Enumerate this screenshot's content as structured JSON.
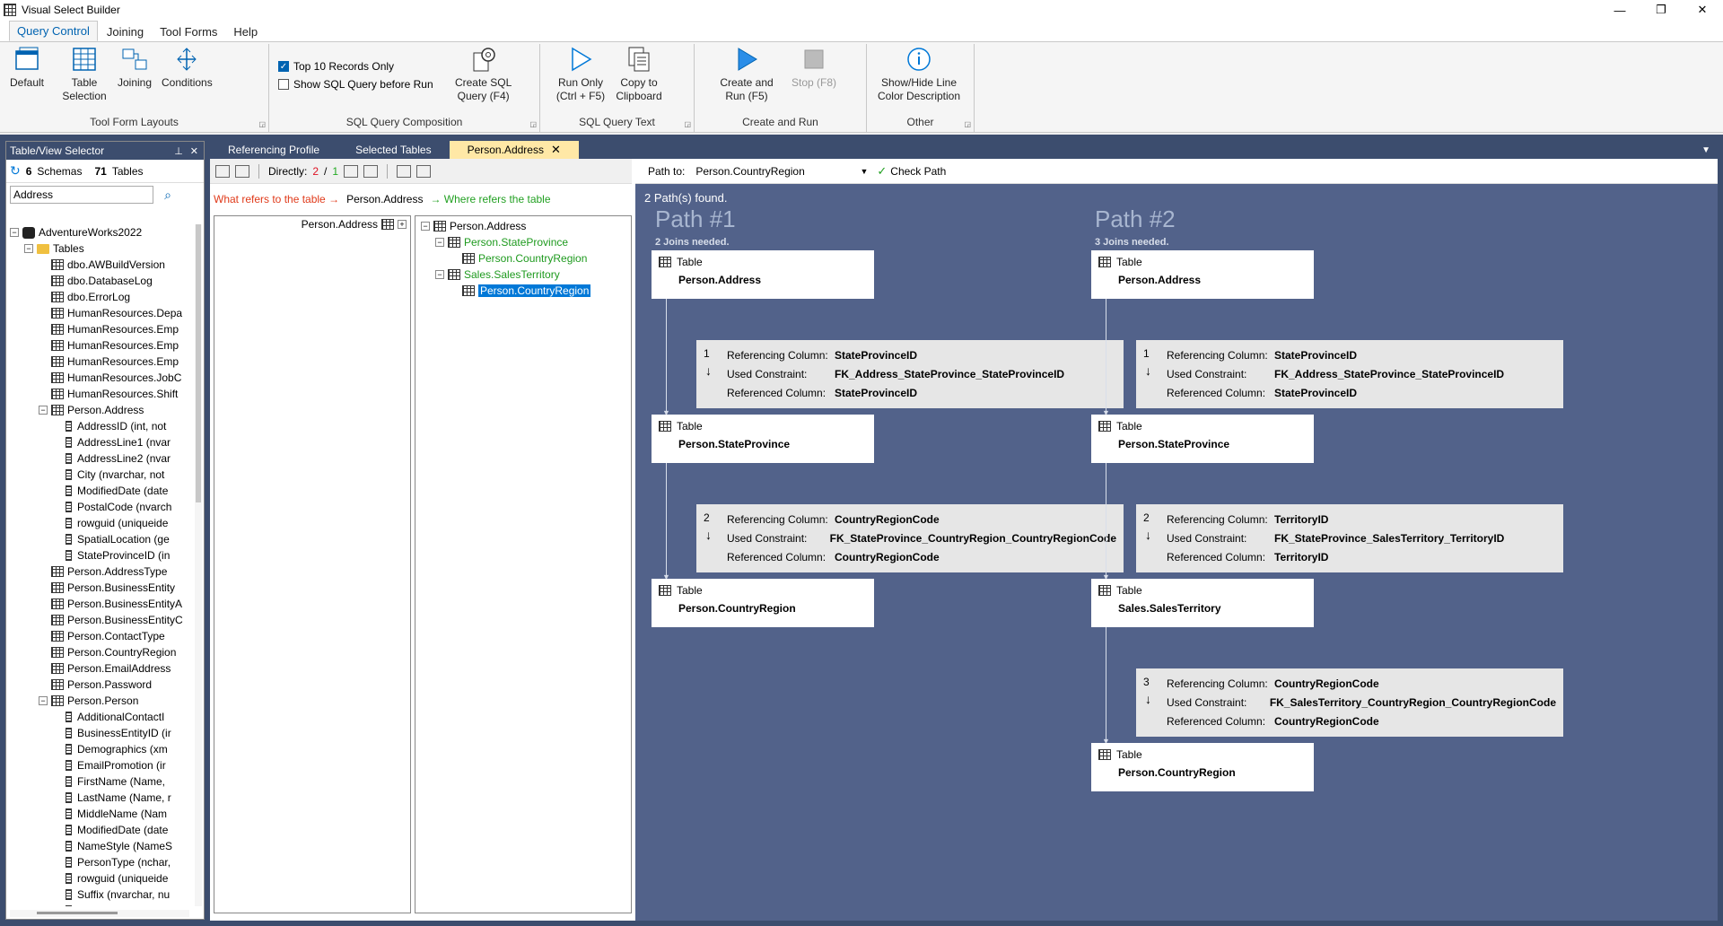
{
  "window": {
    "title": "Visual Select Builder",
    "minimize": "—",
    "maximize": "❐",
    "close": "✕"
  },
  "menu_tabs": [
    "Query Control",
    "Joining",
    "Tool Forms",
    "Help"
  ],
  "ribbon": {
    "groups": [
      {
        "label": "Tool Form Layouts",
        "buttons": [
          "Default",
          "Table Selection",
          "Joining",
          "Conditions"
        ]
      },
      {
        "label": "SQL Query Composition",
        "checkboxes": [
          {
            "label": "Top 10 Records Only",
            "checked": true
          },
          {
            "label": "Show SQL Query before Run",
            "checked": false
          }
        ],
        "buttons": [
          "Create SQL Query (F4)"
        ]
      },
      {
        "label": "SQL Query Text",
        "buttons": [
          "Run Only (Ctrl + F5)",
          "Copy to Clipboard"
        ]
      },
      {
        "label": "Create and Run",
        "buttons": [
          "Create and Run (F5)",
          "Stop (F8)"
        ]
      },
      {
        "label": "Other",
        "buttons": [
          "Show/Hide Line Color Description"
        ]
      }
    ]
  },
  "left_panel": {
    "title": "Table/View Selector",
    "schemas_count": "6",
    "schemas_label": "Schemas",
    "tables_count": "71",
    "tables_label": "Tables",
    "search_value": "Address",
    "tree": [
      {
        "level": 0,
        "kind": "db",
        "exp": "−",
        "label": "AdventureWorks2022"
      },
      {
        "level": 1,
        "kind": "folder",
        "exp": "−",
        "label": "Tables"
      },
      {
        "level": 2,
        "kind": "table",
        "label": "dbo.AWBuildVersion"
      },
      {
        "level": 2,
        "kind": "table",
        "label": "dbo.DatabaseLog"
      },
      {
        "level": 2,
        "kind": "table",
        "label": "dbo.ErrorLog"
      },
      {
        "level": 2,
        "kind": "table",
        "label": "HumanResources.Depa"
      },
      {
        "level": 2,
        "kind": "table",
        "label": "HumanResources.Emp"
      },
      {
        "level": 2,
        "kind": "table",
        "label": "HumanResources.Emp"
      },
      {
        "level": 2,
        "kind": "table",
        "label": "HumanResources.Emp"
      },
      {
        "level": 2,
        "kind": "table",
        "label": "HumanResources.JobC"
      },
      {
        "level": 2,
        "kind": "table",
        "label": "HumanResources.Shift"
      },
      {
        "level": 2,
        "kind": "table",
        "exp": "−",
        "label": "Person.Address"
      },
      {
        "level": 3,
        "kind": "col",
        "label": "AddressID (int, not"
      },
      {
        "level": 3,
        "kind": "col",
        "label": "AddressLine1 (nvar"
      },
      {
        "level": 3,
        "kind": "col",
        "label": "AddressLine2 (nvar"
      },
      {
        "level": 3,
        "kind": "col",
        "label": "City (nvarchar, not"
      },
      {
        "level": 3,
        "kind": "col",
        "label": "ModifiedDate (date"
      },
      {
        "level": 3,
        "kind": "col",
        "label": "PostalCode (nvarch"
      },
      {
        "level": 3,
        "kind": "col",
        "label": "rowguid (uniqueide"
      },
      {
        "level": 3,
        "kind": "col",
        "label": "SpatialLocation (ge"
      },
      {
        "level": 3,
        "kind": "col",
        "label": "StateProvinceID (in"
      },
      {
        "level": 2,
        "kind": "table",
        "label": "Person.AddressType"
      },
      {
        "level": 2,
        "kind": "table",
        "label": "Person.BusinessEntity"
      },
      {
        "level": 2,
        "kind": "table",
        "label": "Person.BusinessEntityA"
      },
      {
        "level": 2,
        "kind": "table",
        "label": "Person.BusinessEntityC"
      },
      {
        "level": 2,
        "kind": "table",
        "label": "Person.ContactType"
      },
      {
        "level": 2,
        "kind": "table",
        "label": "Person.CountryRegion"
      },
      {
        "level": 2,
        "kind": "table",
        "label": "Person.EmailAddress"
      },
      {
        "level": 2,
        "kind": "table",
        "label": "Person.Password"
      },
      {
        "level": 2,
        "kind": "table",
        "exp": "−",
        "label": "Person.Person"
      },
      {
        "level": 3,
        "kind": "col",
        "label": "AdditionalContactI"
      },
      {
        "level": 3,
        "kind": "col",
        "label": "BusinessEntityID (ir"
      },
      {
        "level": 3,
        "kind": "col",
        "label": "Demographics (xm"
      },
      {
        "level": 3,
        "kind": "col",
        "label": "EmailPromotion (ir"
      },
      {
        "level": 3,
        "kind": "col",
        "label": "FirstName (Name,"
      },
      {
        "level": 3,
        "kind": "col",
        "label": "LastName (Name, r"
      },
      {
        "level": 3,
        "kind": "col",
        "label": "MiddleName (Nam"
      },
      {
        "level": 3,
        "kind": "col",
        "label": "ModifiedDate (date"
      },
      {
        "level": 3,
        "kind": "col",
        "label": "NameStyle (NameS"
      },
      {
        "level": 3,
        "kind": "col",
        "label": "PersonType (nchar,"
      },
      {
        "level": 3,
        "kind": "col",
        "label": "rowguid (uniqueide"
      },
      {
        "level": 3,
        "kind": "col",
        "label": "Suffix (nvarchar, nu"
      },
      {
        "level": 3,
        "kind": "col",
        "label": "Title (nvarchar, null"
      }
    ]
  },
  "doc_tabs": [
    "Referencing Profile",
    "Selected Tables",
    "Person.Address"
  ],
  "toolbar": {
    "directly_label": "Directly:",
    "count_left": "2",
    "slash": "/",
    "count_right": "1"
  },
  "legend": {
    "refers": "What refers to the table →",
    "table": "Person.Address",
    "where": "→ Where refers the table"
  },
  "ref_list": {
    "item": "Person.Address"
  },
  "where_tree": [
    {
      "level": 0,
      "exp": "−",
      "label": "Person.Address",
      "style": "plain"
    },
    {
      "level": 1,
      "exp": "−",
      "label": "Person.StateProvince",
      "style": "green"
    },
    {
      "level": 2,
      "label": "Person.CountryRegion",
      "style": "green"
    },
    {
      "level": 1,
      "exp": "−",
      "label": "Sales.SalesTerritory",
      "style": "green"
    },
    {
      "level": 2,
      "label": "Person.CountryRegion",
      "style": "selected"
    }
  ],
  "path_bar": {
    "label": "Path to:",
    "value": "Person.CountryRegion",
    "check": "Check Path"
  },
  "found": "2 Path(s) found.",
  "table_word": "Table",
  "join_labels": {
    "ref_col": "Referencing Column:",
    "constraint": "Used Constraint:",
    "refd_col": "Referenced Column:"
  },
  "paths": [
    {
      "title": "Path #1",
      "subtitle": "2 Joins needed.",
      "tables": [
        "Person.Address",
        "Person.StateProvince",
        "Person.CountryRegion"
      ],
      "joins": [
        {
          "n": "1",
          "ref": "StateProvinceID",
          "constraint": "FK_Address_StateProvince_StateProvinceID",
          "refd": "StateProvinceID"
        },
        {
          "n": "2",
          "ref": "CountryRegionCode",
          "constraint": "FK_StateProvince_CountryRegion_CountryRegionCode",
          "refd": "CountryRegionCode"
        }
      ]
    },
    {
      "title": "Path #2",
      "subtitle": "3 Joins needed.",
      "tables": [
        "Person.Address",
        "Person.StateProvince",
        "Sales.SalesTerritory",
        "Person.CountryRegion"
      ],
      "joins": [
        {
          "n": "1",
          "ref": "StateProvinceID",
          "constraint": "FK_Address_StateProvince_StateProvinceID",
          "refd": "StateProvinceID"
        },
        {
          "n": "2",
          "ref": "TerritoryID",
          "constraint": "FK_StateProvince_SalesTerritory_TerritoryID",
          "refd": "TerritoryID"
        },
        {
          "n": "3",
          "ref": "CountryRegionCode",
          "constraint": "FK_SalesTerritory_CountryRegion_CountryRegionCode",
          "refd": "CountryRegionCode"
        }
      ]
    }
  ]
}
